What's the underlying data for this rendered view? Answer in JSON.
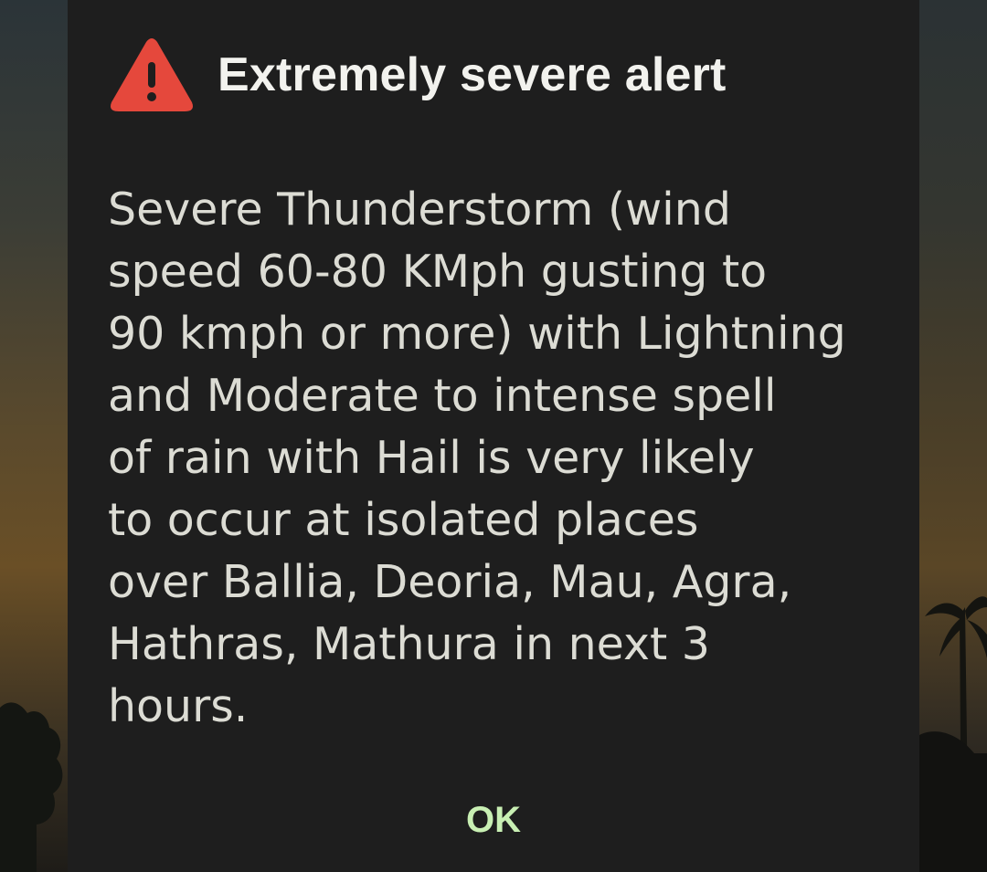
{
  "dialog": {
    "icon": "warning-triangle-icon",
    "icon_color": "#e5483c",
    "title": "Extremely severe alert",
    "message_lines": [
      "Severe Thunderstorm (wind",
      "speed 60-80 KMph gusting to",
      "90 kmph or more) with Lightning",
      "and Moderate to intense spell",
      "of rain with Hail is very likely",
      "to occur at isolated places",
      "over Ballia, Deoria, Mau, Agra,",
      "Hathras, Mathura in next 3",
      "hours."
    ],
    "ok_label": "OK",
    "ok_color": "#c8efb3"
  }
}
